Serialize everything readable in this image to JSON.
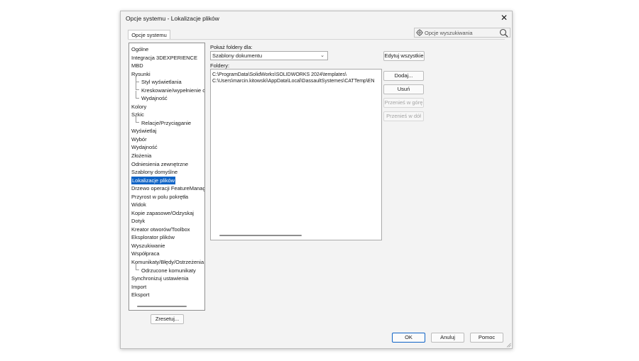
{
  "dialog": {
    "title": "Opcje systemu - Lokalizacje plików",
    "close_icon": "close-icon",
    "tab_label": "Opcje systemu",
    "search": {
      "placeholder": "Opcje wyszukiwania",
      "icons": [
        "gear-icon",
        "search-icon"
      ]
    }
  },
  "tree": {
    "selected": "Lokalizacje plików",
    "items": [
      {
        "label": "Ogólne",
        "level": 0
      },
      {
        "label": "Integracja 3DEXPERIENCE",
        "level": 0
      },
      {
        "label": "MBD",
        "level": 0
      },
      {
        "label": "Rysunki",
        "level": 0
      },
      {
        "label": "Styl wyświetlania",
        "level": 1
      },
      {
        "label": "Kreskowanie/wypełnienie o",
        "level": 1
      },
      {
        "label": "Wydajność",
        "level": 1
      },
      {
        "label": "Kolory",
        "level": 0
      },
      {
        "label": "Szkic",
        "level": 0
      },
      {
        "label": "Relacje/Przyciąganie",
        "level": 1
      },
      {
        "label": "Wyświetlaj",
        "level": 0
      },
      {
        "label": "Wybór",
        "level": 0
      },
      {
        "label": "Wydajność",
        "level": 0
      },
      {
        "label": "Złożenia",
        "level": 0
      },
      {
        "label": "Odniesienia zewnętrzne",
        "level": 0
      },
      {
        "label": "Szablony domyślne",
        "level": 0
      },
      {
        "label": "Lokalizacje plików",
        "level": 0
      },
      {
        "label": "Drzewo operacji FeatureManag",
        "level": 0
      },
      {
        "label": "Przyrost w polu pokrętła",
        "level": 0
      },
      {
        "label": "Widok",
        "level": 0
      },
      {
        "label": "Kopie zapasowe/Odzyskaj",
        "level": 0
      },
      {
        "label": "Dotyk",
        "level": 0
      },
      {
        "label": "Kreator otworów/Toolbox",
        "level": 0
      },
      {
        "label": "Eksplorator plików",
        "level": 0
      },
      {
        "label": "Wyszukiwanie",
        "level": 0
      },
      {
        "label": "Współpraca",
        "level": 0
      },
      {
        "label": "Komunikaty/Błędy/Ostrzeżenia",
        "level": 0
      },
      {
        "label": "Odrzucone komunikaty",
        "level": 1
      },
      {
        "label": "Synchronizuj ustawienia",
        "level": 0
      },
      {
        "label": "Import",
        "level": 0
      },
      {
        "label": "Eksport",
        "level": 0
      }
    ],
    "reset_button": "Zresetuj..."
  },
  "main": {
    "show_folders_label": "Pokaż foldery dla:",
    "show_folders_value": "Szablony dokumentu",
    "folders_label": "Foldery:",
    "folders": [
      "C:\\ProgramData\\SolidWorks\\SOLIDWORKS 2024\\templates\\",
      "C:\\Users\\marcin.kitowski\\AppData\\Local\\DassaultSystemes\\CATTemp\\EN"
    ],
    "buttons": {
      "edit_all": "Edytuj wszystkie",
      "add": "Dodaj...",
      "remove": "Usuń",
      "move_up": "Przenieś w górę",
      "move_down": "Przenieś w dół"
    }
  },
  "footer": {
    "ok": "OK",
    "cancel": "Anuluj",
    "help": "Pomoc"
  },
  "colors": {
    "selection": "#1064c6",
    "dialog_bg": "#f3f3f3"
  }
}
